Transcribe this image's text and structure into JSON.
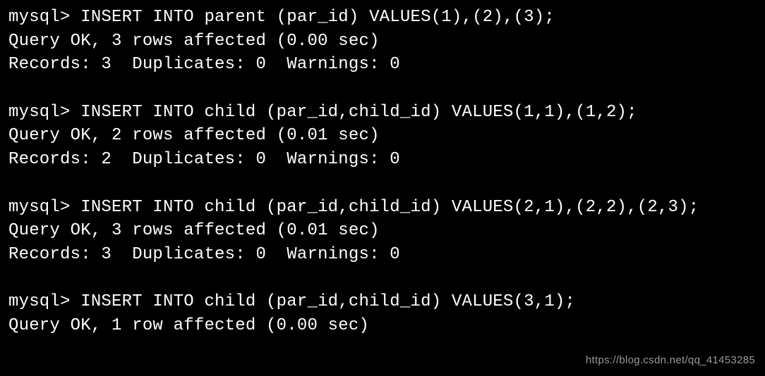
{
  "terminal": {
    "prompt": "mysql> ",
    "blocks": [
      {
        "command": "INSERT INTO parent (par_id) VALUES(1),(2),(3);",
        "result_line": "Query OK, 3 rows affected (0.00 sec)",
        "stats_line": "Records: 3  Duplicates: 0  Warnings: 0"
      },
      {
        "command": "INSERT INTO child (par_id,child_id) VALUES(1,1),(1,2);",
        "result_line": "Query OK, 2 rows affected (0.01 sec)",
        "stats_line": "Records: 2  Duplicates: 0  Warnings: 0"
      },
      {
        "command": "INSERT INTO child (par_id,child_id) VALUES(2,1),(2,2),(2,3);",
        "result_line": "Query OK, 3 rows affected (0.01 sec)",
        "stats_line": "Records: 3  Duplicates: 0  Warnings: 0"
      },
      {
        "command": "INSERT INTO child (par_id,child_id) VALUES(3,1);",
        "result_line": "Query OK, 1 row affected (0.00 sec)",
        "stats_line": ""
      }
    ]
  },
  "watermark": "https://blog.csdn.net/qq_41453285"
}
